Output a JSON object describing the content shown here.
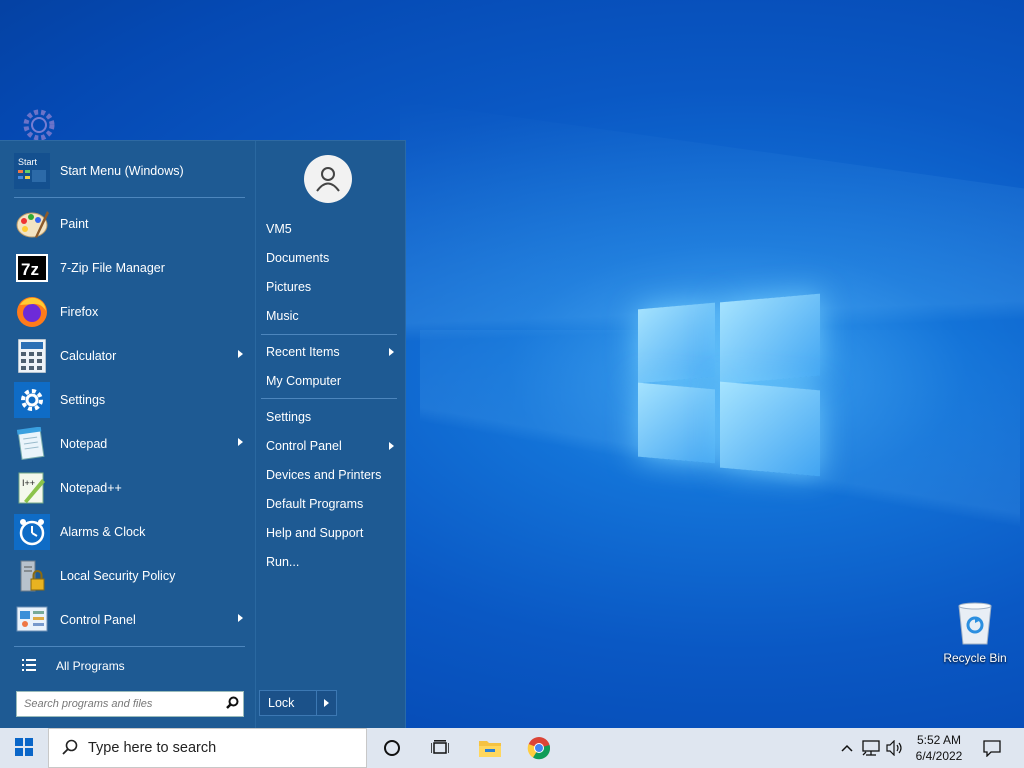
{
  "desktop": {
    "recycle_bin_label": "Recycle Bin"
  },
  "start_menu": {
    "header_item": {
      "label": "Start Menu (Windows)",
      "icon": "start-menu-icon",
      "icon_text": "Start"
    },
    "apps": [
      {
        "label": "Paint",
        "icon": "paint-icon",
        "submenu": false
      },
      {
        "label": "7-Zip File Manager",
        "icon": "7zip-icon",
        "submenu": false
      },
      {
        "label": "Firefox",
        "icon": "firefox-icon",
        "submenu": false
      },
      {
        "label": "Calculator",
        "icon": "calculator-icon",
        "submenu": true
      },
      {
        "label": "Settings",
        "icon": "settings-gear-icon",
        "submenu": false
      },
      {
        "label": "Notepad",
        "icon": "notepad-icon",
        "submenu": true
      },
      {
        "label": "Notepad++",
        "icon": "notepadpp-icon",
        "submenu": false
      },
      {
        "label": "Alarms & Clock",
        "icon": "alarm-clock-icon",
        "submenu": false
      },
      {
        "label": "Local Security Policy",
        "icon": "security-policy-icon",
        "submenu": false
      },
      {
        "label": "Control Panel",
        "icon": "control-panel-icon",
        "submenu": true
      }
    ],
    "all_programs_label": "All Programs",
    "search_placeholder": "Search programs and files",
    "right_panel": {
      "user": "VM5",
      "group1": [
        "Documents",
        "Pictures",
        "Music"
      ],
      "group2": [
        {
          "label": "Recent Items",
          "submenu": true
        },
        {
          "label": "My Computer",
          "submenu": false
        }
      ],
      "group3": [
        {
          "label": "Settings",
          "submenu": false
        },
        {
          "label": "Control Panel",
          "submenu": true
        },
        {
          "label": "Devices and Printers",
          "submenu": false
        },
        {
          "label": "Default Programs",
          "submenu": false
        },
        {
          "label": "Help and Support",
          "submenu": false
        },
        {
          "label": "Run...",
          "submenu": false
        }
      ],
      "lock_label": "Lock"
    }
  },
  "taskbar": {
    "search_text": "Type here to search",
    "pinned": [
      "cortana-icon",
      "task-view-icon",
      "file-explorer-icon",
      "chrome-icon"
    ],
    "time": "5:52 AM",
    "date": "6/4/2022",
    "accent": "#0a58c4"
  }
}
